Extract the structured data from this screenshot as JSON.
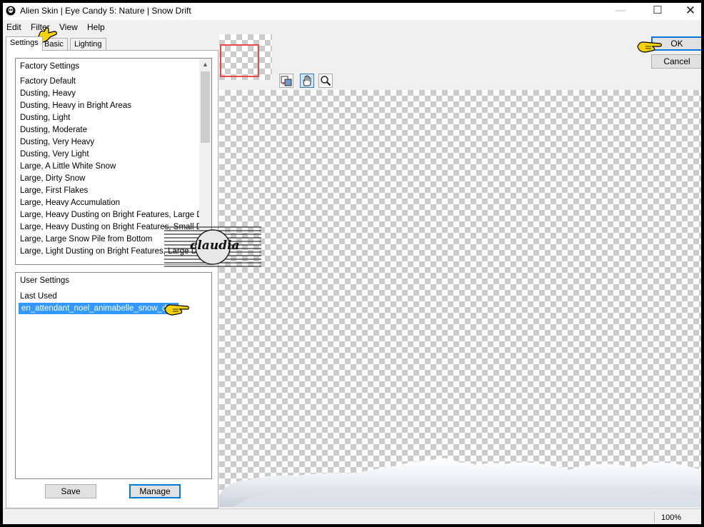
{
  "window": {
    "title": "Alien Skin | Eye Candy 5: Nature | Snow Drift"
  },
  "menu": {
    "edit": "Edit",
    "filter": "Filter",
    "view": "View",
    "help": "Help"
  },
  "tabs": {
    "settings": "Settings",
    "basic": "Basic",
    "lighting": "Lighting"
  },
  "factory": {
    "header": "Factory Settings",
    "items": [
      "Factory Default",
      "Dusting, Heavy",
      "Dusting, Heavy in Bright Areas",
      "Dusting, Light",
      "Dusting, Moderate",
      "Dusting, Very Heavy",
      "Dusting, Very Light",
      "Large, A Little White Snow",
      "Large, Dirty Snow",
      "Large, First Flakes",
      "Large, Heavy Accumulation",
      "Large, Heavy Dusting on Bright Features, Large Drift",
      "Large, Heavy Dusting on Bright Features, Small Drift",
      "Large, Large Snow Pile from Bottom",
      "Large, Light Dusting on Bright Features, Large Drift"
    ]
  },
  "user": {
    "header": "User Settings",
    "items": [
      "Last Used",
      "en_attendant_noel_animabelle_snow_drift"
    ],
    "selected_index": 1
  },
  "buttons": {
    "save": "Save",
    "manage": "Manage",
    "ok": "OK",
    "cancel": "Cancel"
  },
  "tools": [
    "toggle-preview-icon",
    "hand-icon",
    "zoom-icon"
  ],
  "watermark": {
    "text": "claudia"
  },
  "status": {
    "zoom": "100%"
  },
  "colors": {
    "selection": "#3399ff",
    "default_button_border": "#0078d7",
    "pointer": "#f5d20a",
    "thumb_frame": "#e84848"
  }
}
